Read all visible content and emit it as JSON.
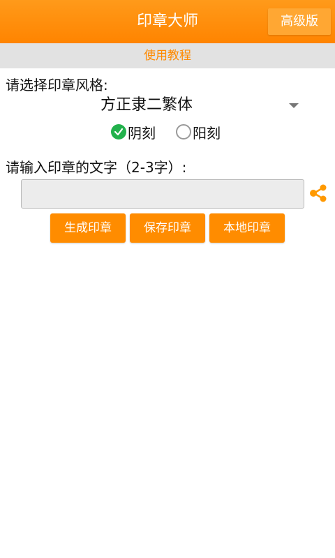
{
  "header": {
    "title": "印章大师",
    "pro_button": "高级版"
  },
  "tutorial_link": "使用教程",
  "style_section": {
    "label": "请选择印章风格:",
    "selected_font": "方正隶二繁体",
    "options": [
      {
        "label": "阴刻",
        "checked": true
      },
      {
        "label": "阳刻",
        "checked": false
      }
    ]
  },
  "text_section": {
    "label": "请输入印章的文字（2-3字）:",
    "input_value": "",
    "input_placeholder": ""
  },
  "actions": {
    "generate": "生成印章",
    "save": "保存印章",
    "local": "本地印章"
  },
  "colors": {
    "accent": "#ff8c00",
    "checked_radio": "#22b14c",
    "share_icon": "#ff9900"
  },
  "icons": [
    "checkmark-icon",
    "dropdown-caret-icon",
    "share-icon"
  ]
}
